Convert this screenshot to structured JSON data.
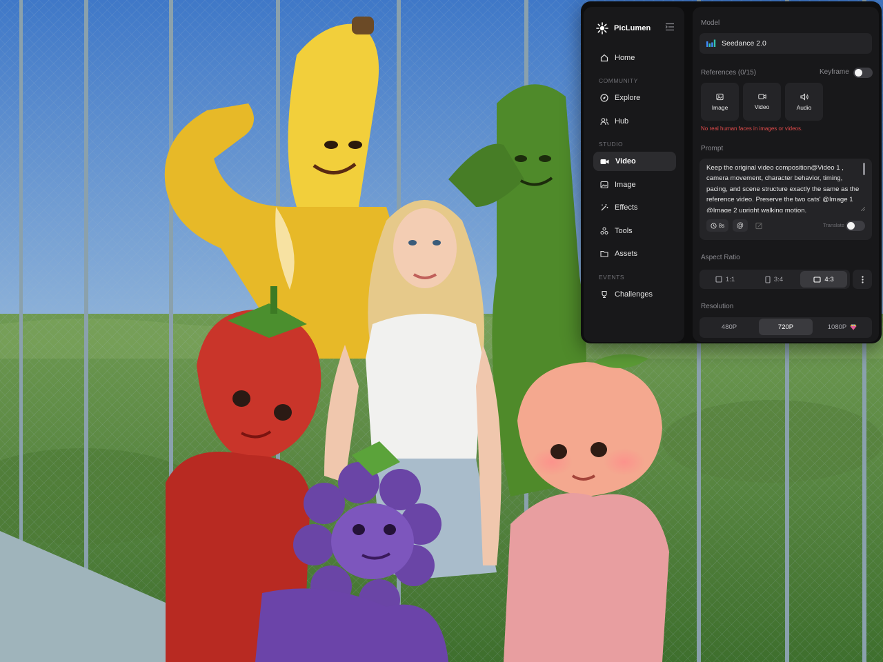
{
  "app": {
    "name": "PicLumen",
    "colors": {
      "panel": "#0e0e0f",
      "sidebar": "#18181a",
      "control": "#242427",
      "warning": "#e24b4b"
    }
  },
  "sidebar": {
    "home": "Home",
    "community_label": "COMMUNITY",
    "explore": "Explore",
    "hub": "Hub",
    "studio_label": "STUDIO",
    "video": "Video",
    "image": "Image",
    "effects": "Effects",
    "tools": "Tools",
    "assets": "Assets",
    "events_label": "EVENTS",
    "challenges": "Challenges",
    "active_item": "Video"
  },
  "main": {
    "model_label": "Model",
    "model_value": "Seedance 2.0",
    "references_label": "References (0/15)",
    "keyframe_label": "Keyframe",
    "keyframe_on": false,
    "ref_image": "Image",
    "ref_video": "Video",
    "ref_audio": "Audio",
    "warning": "No real human faces in images or videos.",
    "prompt_label": "Prompt",
    "prompt_text": "Keep the original video composition@Video 1 , camera movement, character behavior, timing, pacing, and scene structure exactly the same as the reference video. Preserve the two cats' @Image 1 @Image 2 upright walking motion,",
    "duration_chip": "8s",
    "mention_chip": "@",
    "translate_label": "Translate",
    "translate_on": false,
    "aspect_label": "Aspect Ratio",
    "aspect_options": [
      "1:1",
      "3:4",
      "4:3"
    ],
    "aspect_selected": "4:3",
    "resolution_label": "Resolution",
    "resolution_options": [
      "480P",
      "720P",
      "1080P"
    ],
    "resolution_selected": "720P"
  }
}
